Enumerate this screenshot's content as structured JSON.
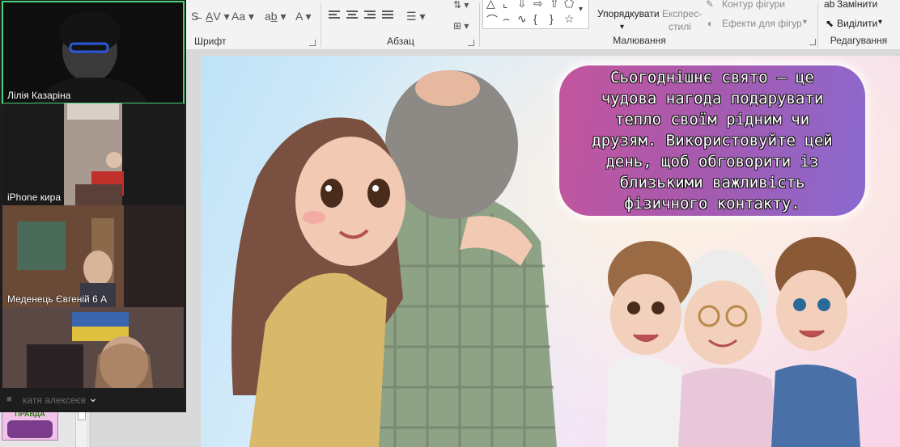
{
  "ribbon": {
    "groups": {
      "font": "Шрифт",
      "paragraph": "Абзац",
      "drawing": "Малювання",
      "editing": "Редагування"
    },
    "arrange_label": "Упорядкувати",
    "quick_styles_label_1": "Експрес-",
    "quick_styles_label_2": "стилі",
    "shape_outline_label": "Контур фігури",
    "shape_effects_label": "Ефекти для фігур",
    "replace_label": "Замінити",
    "select_label": "Виділити"
  },
  "slide": {
    "speech_text": "Сьогоднішнє свято – це чудова нагода подарувати тепло своїм рідним чи друзям. Використовуйте цей день, щоб обговорити із близькими важливість фізичного контакту."
  },
  "thumbnails": {
    "mini_title": "ПРАВДА"
  },
  "participants": [
    {
      "name": "Лілія Казаріна",
      "active": true
    },
    {
      "name": "iPhone кира",
      "active": false
    },
    {
      "name": "Меденець Євгеній 6 А",
      "active": false
    },
    {
      "name": "",
      "active": false
    }
  ],
  "overflow_participant": "катя алексеєв",
  "colors": {
    "active_speaker": "#4ad07a",
    "speech_bubble": "#a55ab0",
    "panel_bg": "#1d1d1d"
  }
}
